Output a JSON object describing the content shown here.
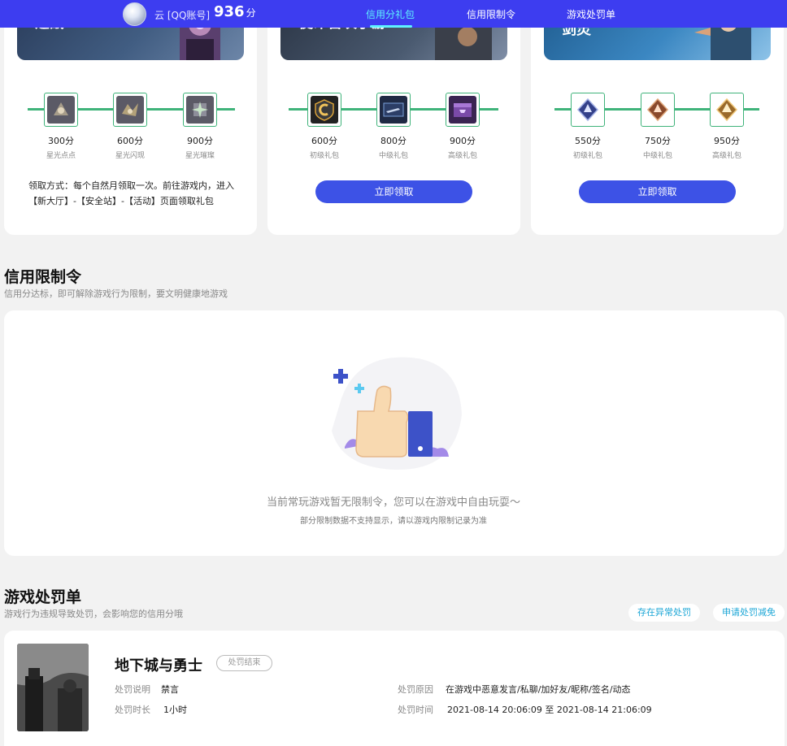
{
  "header": {
    "user_name": "云 [QQ账号]",
    "score": "936",
    "score_unit": "分",
    "tabs": [
      {
        "label": "信用分礼包",
        "active": true
      },
      {
        "label": "信用限制令",
        "active": false
      },
      {
        "label": "游戏处罚单",
        "active": false
      }
    ]
  },
  "gift_cards": [
    {
      "banner_text": "速战",
      "gifts": [
        {
          "points": "300分",
          "name": "星光点点",
          "icon": "star-badge-icon"
        },
        {
          "points": "600分",
          "name": "星光闪现",
          "icon": "star-badge-icon"
        },
        {
          "points": "900分",
          "name": "星光璀璨",
          "icon": "star-badge-icon"
        }
      ],
      "claim_note": "领取方式：每个自然月领取一次。前往游戏内，进入【新大厅】-【安全站】-【活动】页面领取礼包"
    },
    {
      "banner_text": "使命召唤手游",
      "gifts": [
        {
          "points": "600分",
          "name": "初级礼包",
          "icon": "shield-c-icon"
        },
        {
          "points": "800分",
          "name": "中级礼包",
          "icon": "weapon-card-icon"
        },
        {
          "points": "900分",
          "name": "高级礼包",
          "icon": "gift-crate-icon"
        }
      ],
      "claim_button": "立即领取"
    },
    {
      "banner_text": "剑灵",
      "gifts": [
        {
          "points": "550分",
          "name": "初级礼包",
          "icon": "blue-crest-icon"
        },
        {
          "points": "750分",
          "name": "中级礼包",
          "icon": "bronze-crest-icon"
        },
        {
          "points": "950分",
          "name": "高级礼包",
          "icon": "gold-crest-icon"
        }
      ],
      "claim_button": "立即领取"
    }
  ],
  "restriction": {
    "title": "信用限制令",
    "desc": "信用分达标，即可解除游戏行为限制，要文明健康地游戏",
    "empty_text": "当前常玩游戏暂无限制令，您可以在游戏中自由玩耍～",
    "empty_subtext": "部分限制数据不支持显示，请以游戏内限制记录为准"
  },
  "penalty": {
    "title": "游戏处罚单",
    "desc": "游戏行为违规导致处罚，会影响您的信用分哦",
    "buttons": [
      "存在异常处罚",
      "申请处罚减免"
    ],
    "record": {
      "game": "地下城与勇士",
      "status": "处罚结束",
      "desc_label": "处罚说明",
      "desc_value": "禁言",
      "duration_label": "处罚时长",
      "duration_value": "1小时",
      "reason_label": "处罚原因",
      "reason_value": "在游戏中恶意发言/私聊/加好友/昵称/签名/动态",
      "time_label": "处罚时间",
      "time_value": "2021-08-14 20:06:09 至 2021-08-14 21:06:09"
    }
  },
  "colors": {
    "topbar": "#3d3df0",
    "active_tab": "#5ff3ff",
    "button": "#3d52e6",
    "track": "#3fb37a",
    "pill_text": "#1ba6d6"
  }
}
